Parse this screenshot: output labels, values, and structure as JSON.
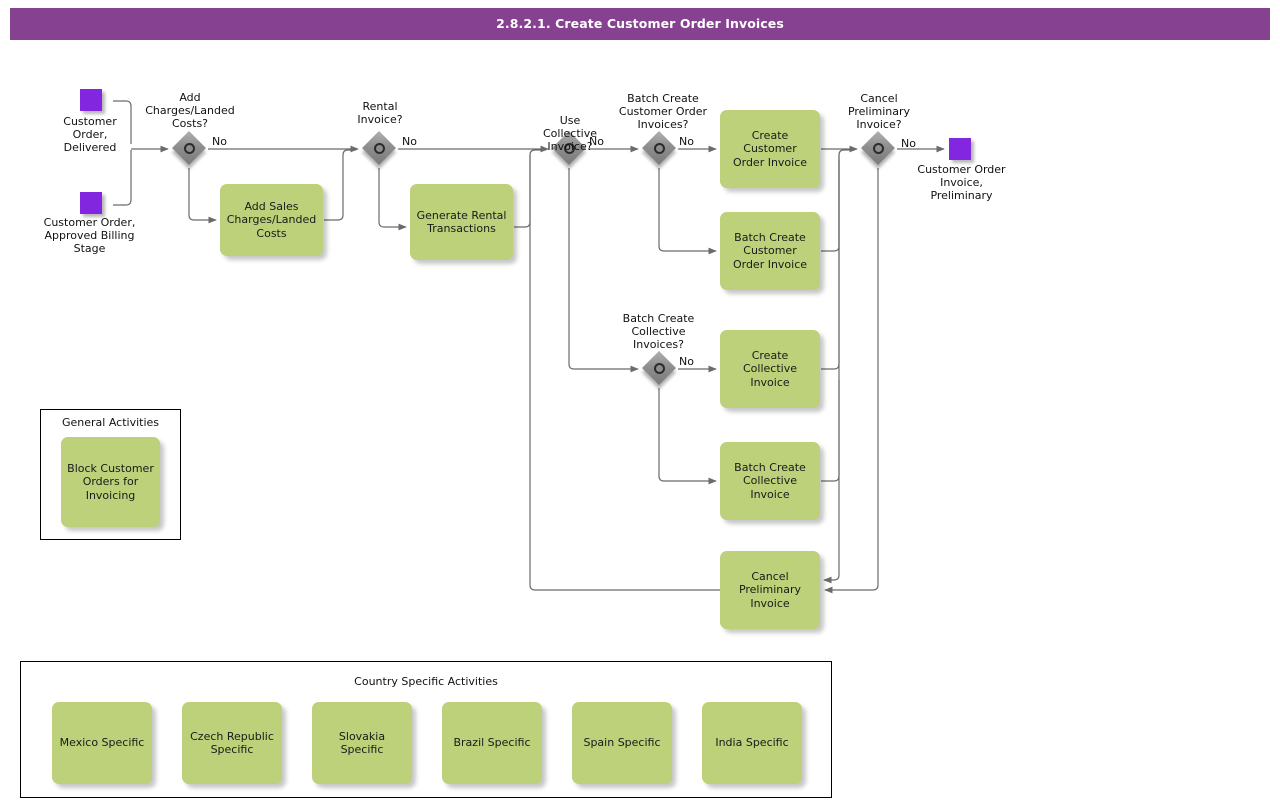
{
  "header": {
    "title": "2.8.2.1. Create Customer Order Invoices",
    "bar_color": "#874191",
    "text_color": "#ffffff"
  },
  "palette": {
    "activity_fill": "#bcd179",
    "event_fill": "#8226e0",
    "gateway_fill": "#8f8f8f",
    "connector": "#6b6b6b",
    "frame": "#000000"
  },
  "events": [
    {
      "id": "start_delivered",
      "label": "Customer\nOrder,\nDelivered",
      "type": "start-event"
    },
    {
      "id": "start_approved",
      "label": "Customer Order,\nApproved Billing\nStage",
      "type": "start-event"
    },
    {
      "id": "end_preliminary",
      "label": "Customer Order\nInvoice,\nPreliminary",
      "type": "end-event"
    }
  ],
  "gateways": [
    {
      "id": "gw_add_charges",
      "label": "Add\nCharges/Landed\nCosts?",
      "no_label": "No"
    },
    {
      "id": "gw_rental_invoice",
      "label": "Rental\nInvoice?",
      "no_label": "No"
    },
    {
      "id": "gw_use_collective",
      "label": "Use\nCollective\nInvoice?",
      "no_label": "No"
    },
    {
      "id": "gw_batch_create_co",
      "label": "Batch Create\nCustomer Order\nInvoices?",
      "no_label": "No"
    },
    {
      "id": "gw_batch_create_collective",
      "label": "Batch Create\nCollective\nInvoices?",
      "no_label": "No"
    },
    {
      "id": "gw_cancel_preliminary",
      "label": "Cancel\nPreliminary\nInvoice?",
      "no_label": "No"
    }
  ],
  "activities": [
    {
      "id": "act_add_sales_charges",
      "label": "Add Sales\nCharges/Landed\nCosts"
    },
    {
      "id": "act_generate_rental",
      "label": "Generate Rental\nTransactions"
    },
    {
      "id": "act_create_co_invoice",
      "label": "Create\nCustomer Order\nInvoice"
    },
    {
      "id": "act_batch_create_co_invoice",
      "label": "Batch Create\nCustomer\nOrder Invoice"
    },
    {
      "id": "act_create_collective_invoice",
      "label": "Create\nCollective\nInvoice"
    },
    {
      "id": "act_batch_create_collective_invoice",
      "label": "Batch Create\nCollective\nInvoice"
    },
    {
      "id": "act_cancel_preliminary_invoice",
      "label": "Cancel\nPreliminary\nInvoice"
    }
  ],
  "general_activities": {
    "title": "General Activities",
    "items": [
      {
        "id": "act_block_customer_orders",
        "label": "Block Customer\nOrders for\nInvoicing"
      }
    ]
  },
  "country_specific_activities": {
    "title": "Country Specific Activities",
    "items": [
      {
        "id": "act_mexico",
        "label": "Mexico Specific"
      },
      {
        "id": "act_czech",
        "label": "Czech Republic\nSpecific"
      },
      {
        "id": "act_slovakia",
        "label": "Slovakia\nSpecific"
      },
      {
        "id": "act_brazil",
        "label": "Brazil Specific"
      },
      {
        "id": "act_spain",
        "label": "Spain Specific"
      },
      {
        "id": "act_india",
        "label": "India Specific"
      }
    ]
  }
}
